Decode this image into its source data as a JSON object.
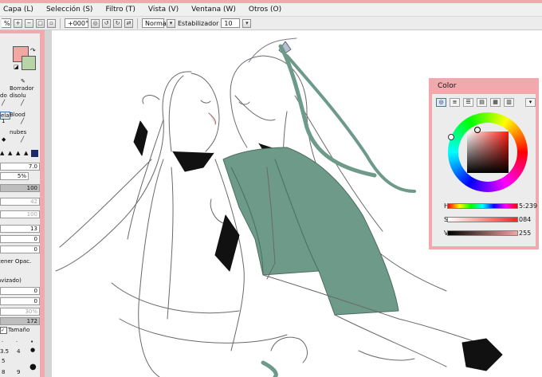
{
  "menu": {
    "items": [
      "Capa (L)",
      "Selección (S)",
      "Filtro (T)",
      "Vista (V)",
      "Ventana (W)",
      "Otros (O)"
    ]
  },
  "toolbar": {
    "zoom_fragment": "%",
    "rotation": "+000°",
    "blend_mode": "Normal",
    "stabilizer_label": "Estabilizador",
    "stabilizer_value": "10"
  },
  "tool_panel": {
    "tools": [
      "Borrador",
      "do",
      "disolu",
      "ela",
      "Blood",
      "1",
      "nubes"
    ],
    "values": {
      "v1": "7.0",
      "v2": "5%",
      "v3": "100",
      "v4": "42",
      "v5": "100",
      "v6": "13",
      "v7": "0",
      "v8": "0",
      "v9": "0",
      "v10": "0",
      "v11": "30%",
      "v12": "172"
    },
    "mantener_label": "tener Opac.",
    "suavizado_label": "avizado)",
    "tamano_label": "Tamaño",
    "brush_sizes": [
      "3.5",
      "4",
      "5",
      "8",
      "9"
    ]
  },
  "color_panel": {
    "title": "Color",
    "hue_label": "H",
    "hue_value": "5:239",
    "sat_label": "S",
    "sat_value": "084",
    "val_label": "V",
    "val_value": "255",
    "hue": 5,
    "saturation": 84,
    "value": 255,
    "current_color": "#f3a6a2"
  },
  "colors": {
    "accent_pink": "#f2a9ad",
    "robe_green": "#6e9a89"
  }
}
